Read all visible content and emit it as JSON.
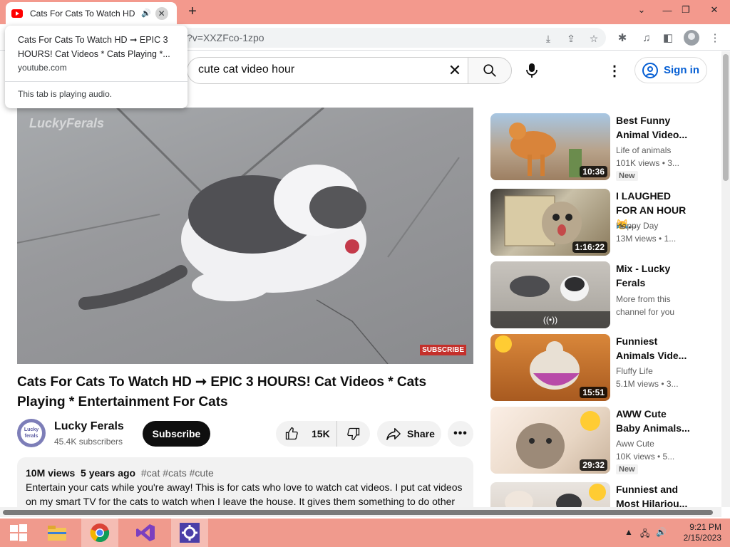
{
  "browser": {
    "tab_title": "Cats For Cats To Watch HD",
    "tab_audio": "🔊",
    "tab_close": "✕",
    "new_tab": "+",
    "url_fragment": "?v=XXZFco-1zpo",
    "hover_card": {
      "title": "Cats For Cats To Watch HD ➞ EPIC 3 HOURS! Cat Videos * Cats Playing *...",
      "domain": "youtube.com",
      "audio_status": "This tab is playing audio."
    }
  },
  "youtube": {
    "search_value": "cute cat video hour",
    "sign_in": "Sign in",
    "player": {
      "watermark": "LuckyFerals",
      "subscribe_mark": "SUBSCRIBE"
    },
    "video": {
      "title": "Cats For Cats To Watch HD ➞ EPIC 3 HOURS! Cat Videos * Cats Playing * Entertainment For Cats",
      "channel": "Lucky Ferals",
      "avatar_text": "Lucky ferals",
      "subscribers": "45.4K subscribers",
      "subscribe_label": "Subscribe",
      "likes": "15K",
      "share_label": "Share",
      "more": "•••",
      "views": "10M views",
      "age": "5 years ago",
      "hashtags": "#cat #cats #cute",
      "description": "Entertain your cats while you're away! This is for cats who love to watch cat videos. I put cat videos on my smart TV for the cats to watch when I leave the house. It gives them something to do other"
    },
    "recommendations": [
      {
        "title": "Best Funny Animal Video...",
        "channel": "Life of animals",
        "views": "101K views • 3...",
        "duration": "10:36",
        "badge": "New"
      },
      {
        "title": "I LAUGHED FOR AN HOUR😹...",
        "channel": "Happy Day",
        "views": "13M views • 1...",
        "duration": "1:16:22",
        "badge": ""
      },
      {
        "title": "Mix - Lucky Ferals",
        "channel": "More from this channel for you",
        "views": "",
        "duration": "",
        "badge": ""
      },
      {
        "title": "Funniest Animals Vide...",
        "channel": "Fluffy Life",
        "views": "5.1M views • 3...",
        "duration": "15:51",
        "badge": ""
      },
      {
        "title": "AWW Cute Baby Animals...",
        "channel": "Aww Cute",
        "views": "10K views • 5...",
        "duration": "29:32",
        "badge": "New"
      },
      {
        "title": "Funniest and Most Hilariou...",
        "channel": "",
        "views": "",
        "duration": "",
        "badge": ""
      }
    ]
  },
  "taskbar": {
    "time": "9:21 PM",
    "date": "2/15/2023"
  },
  "colors": {
    "tab_strip": "#f3998d",
    "taskbar": "#f09a8d",
    "youtube_red": "#ff0000",
    "link_blue": "#065fd4"
  }
}
